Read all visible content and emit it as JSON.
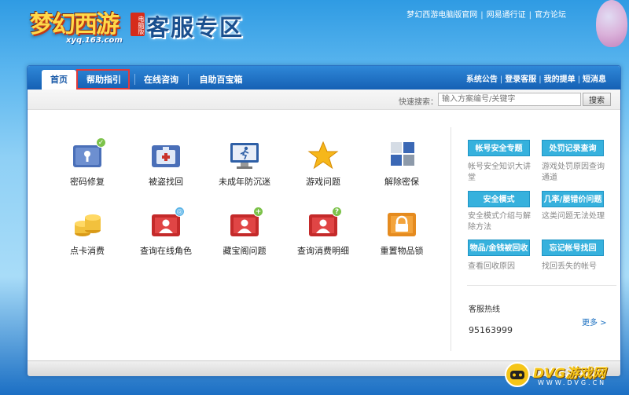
{
  "header": {
    "logo_text": "梦幻西游",
    "logo_badge": "电脑版",
    "logo_url": "xyq.163.com",
    "zone_title": "客服专区",
    "top_links": [
      "梦幻西游电脑版官网",
      "网易通行证",
      "官方论坛"
    ]
  },
  "nav": {
    "tabs": [
      "首页",
      "帮助指引",
      "在线咨询",
      "自助百宝箱"
    ],
    "right_links": [
      "系统公告",
      "登录客服",
      "我的提单",
      "短消息"
    ]
  },
  "search": {
    "label": "快速搜索：",
    "placeholder": "输入方案编号/关键字",
    "button": "搜索"
  },
  "services": [
    {
      "label": "密码修复",
      "icon": "password-repair-icon",
      "badge": "✓",
      "badge_color": "#7cc24a"
    },
    {
      "label": "被盗找回",
      "icon": "stolen-recovery-icon"
    },
    {
      "label": "未成年防沉迷",
      "icon": "minor-anti-addiction-icon"
    },
    {
      "label": "游戏问题",
      "icon": "star-icon"
    },
    {
      "label": "解除密保",
      "icon": "unlock-security-icon"
    },
    {
      "label": "点卡消费",
      "icon": "coins-icon"
    },
    {
      "label": "查询在线角色",
      "icon": "search-role-icon",
      "badge": "◎",
      "badge_color": "#5fb6e8"
    },
    {
      "label": "藏宝阁问题",
      "icon": "treasure-pavilion-icon",
      "badge": "+",
      "badge_color": "#7cc24a"
    },
    {
      "label": "查询消费明细",
      "icon": "consumption-detail-icon",
      "badge": "?",
      "badge_color": "#7cc24a"
    },
    {
      "label": "重置物品锁",
      "icon": "lock-icon"
    }
  ],
  "quick": [
    {
      "title": "帐号安全专题",
      "desc": "帐号安全知识大讲堂"
    },
    {
      "title": "处罚记录查询",
      "desc": "游戏处罚原因查询通道"
    },
    {
      "title": "安全模式",
      "desc": "安全模式介绍与解除方法"
    },
    {
      "title": "几率/屡错价问题",
      "desc": "这类问题无法处理"
    },
    {
      "title": "物品/金钱被回收",
      "desc": "查看回收原因"
    },
    {
      "title": "忘记帐号找回",
      "desc": "找回丢失的帐号"
    }
  ],
  "hotline": {
    "label": "客服热线",
    "more": "更多 >",
    "number": "95163999"
  },
  "watermark": {
    "text": "DVG游戏网",
    "sub": "WWW.DVG.CN"
  },
  "colors": {
    "nav_blue": "#1560b4",
    "quick_button": "#36b1dd",
    "highlight_red": "#e23a3a"
  }
}
